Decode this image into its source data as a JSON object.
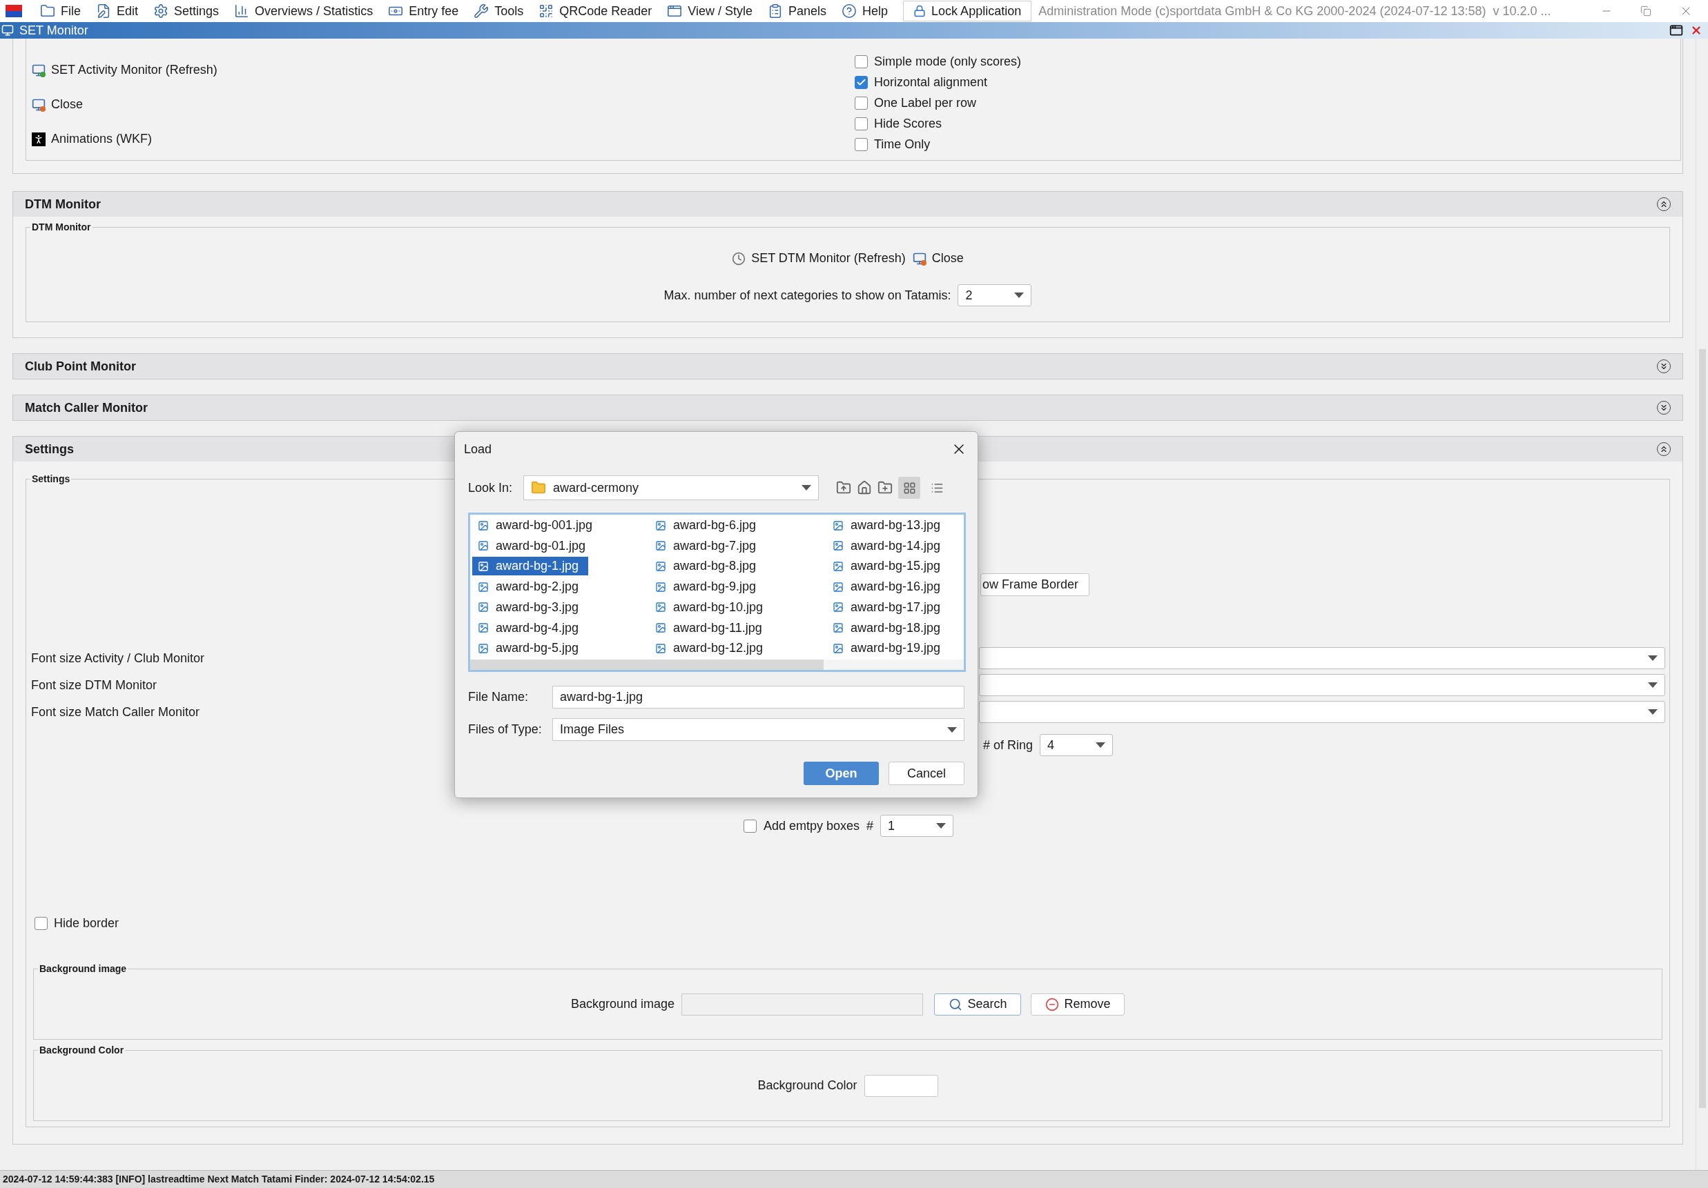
{
  "menu_bar": {
    "items": [
      {
        "label": "File",
        "kind": "folder"
      },
      {
        "label": "Edit",
        "kind": "edit"
      },
      {
        "label": "Settings",
        "kind": "gear"
      },
      {
        "label": "Overviews / Statistics",
        "kind": "chart"
      },
      {
        "label": "Entry fee",
        "kind": "money"
      },
      {
        "label": "Tools",
        "kind": "wrench"
      },
      {
        "label": "QRCode Reader",
        "kind": "qr"
      },
      {
        "label": "View / Style",
        "kind": "window"
      },
      {
        "label": "Panels",
        "kind": "panel"
      },
      {
        "label": "Help",
        "kind": "help"
      }
    ],
    "lock_button": "Lock Application",
    "info": "Administration Mode (c)sportdata GmbH & Co KG 2000-2024 (2024-07-12 13:58)  v 10.2.0 ..."
  },
  "window": {
    "title": "SET Monitor"
  },
  "activity_section": {
    "actions": [
      {
        "label": "SET Activity Monitor (Refresh)",
        "kind": "refresh"
      },
      {
        "label": "Close",
        "kind": "close"
      },
      {
        "label": "Animations (WKF)",
        "kind": "animation"
      }
    ],
    "options": [
      {
        "label": "Simple mode (only scores)",
        "checked": false
      },
      {
        "label": "Horizontal alignment",
        "checked": true
      },
      {
        "label": "One Label per row",
        "checked": false
      },
      {
        "label": "Hide Scores",
        "checked": false
      },
      {
        "label": "Time Only",
        "checked": false
      }
    ]
  },
  "dtm_section": {
    "title": "DTM Monitor",
    "expanded": true,
    "group_title": "DTM Monitor",
    "refresh_button": "SET DTM Monitor (Refresh)",
    "close_button": "Close",
    "max_label": "Max. number of next categories to show on Tatamis:",
    "max_value": "2"
  },
  "collapsed_sections": [
    {
      "title": "Club Point Monitor",
      "expanded": false
    },
    {
      "title": "Match Caller Monitor",
      "expanded": false
    }
  ],
  "settings_section": {
    "title": "Settings",
    "expanded": true,
    "group_title": "Settings",
    "frame_border_button": "ow Frame Border",
    "font_sizes": [
      {
        "label": "Font size Activity / Club Monitor"
      },
      {
        "label": "Font size DTM Monitor"
      },
      {
        "label": "Font size Match Caller Monitor"
      }
    ],
    "ring_label": "# of Ring",
    "ring_value": "4",
    "empty_boxes": {
      "label": "Add emtpy boxes",
      "checked": false,
      "hash": "#",
      "value": "1"
    },
    "hide_border": {
      "label": "Hide border",
      "checked": false
    },
    "background_image": {
      "group_title": "Background image",
      "label": "Background image",
      "search_button": "Search",
      "remove_button": "Remove"
    },
    "background_color": {
      "group_title": "Background Color",
      "label": "Background Color"
    }
  },
  "dialog": {
    "title": "Load",
    "look_in_label": "Look In:",
    "look_in_value": "award-cermony",
    "views": [
      {
        "kind": "grid",
        "selected": true
      },
      {
        "kind": "list",
        "selected": false
      }
    ],
    "files": [
      {
        "name": "award-bg-001.jpg",
        "selected": false
      },
      {
        "name": "award-bg-01.jpg",
        "selected": false
      },
      {
        "name": "award-bg-1.jpg",
        "selected": true
      },
      {
        "name": "award-bg-2.jpg",
        "selected": false
      },
      {
        "name": "award-bg-3.jpg",
        "selected": false
      },
      {
        "name": "award-bg-4.jpg",
        "selected": false
      },
      {
        "name": "award-bg-5.jpg",
        "selected": false
      },
      {
        "name": "award-bg-6.jpg",
        "selected": false
      },
      {
        "name": "award-bg-7.jpg",
        "selected": false
      },
      {
        "name": "award-bg-8.jpg",
        "selected": false
      },
      {
        "name": "award-bg-9.jpg",
        "selected": false
      },
      {
        "name": "award-bg-10.jpg",
        "selected": false
      },
      {
        "name": "award-bg-11.jpg",
        "selected": false
      },
      {
        "name": "award-bg-12.jpg",
        "selected": false
      },
      {
        "name": "award-bg-13.jpg",
        "selected": false
      },
      {
        "name": "award-bg-14.jpg",
        "selected": false
      },
      {
        "name": "award-bg-15.jpg",
        "selected": false
      },
      {
        "name": "award-bg-16.jpg",
        "selected": false
      },
      {
        "name": "award-bg-17.jpg",
        "selected": false
      },
      {
        "name": "award-bg-18.jpg",
        "selected": false
      },
      {
        "name": "award-bg-19.jpg",
        "selected": false
      }
    ],
    "file_name_label": "File Name:",
    "file_name_value": "award-bg-1.jpg",
    "file_type_label": "Files of Type:",
    "file_type_value": "Image Files",
    "open_button": "Open",
    "cancel_button": "Cancel"
  },
  "status_bar": "2024-07-12 14:59:44:383 [INFO] lastreadtime Next Match Tatami Finder: 2024-07-12 14:54:02.15"
}
